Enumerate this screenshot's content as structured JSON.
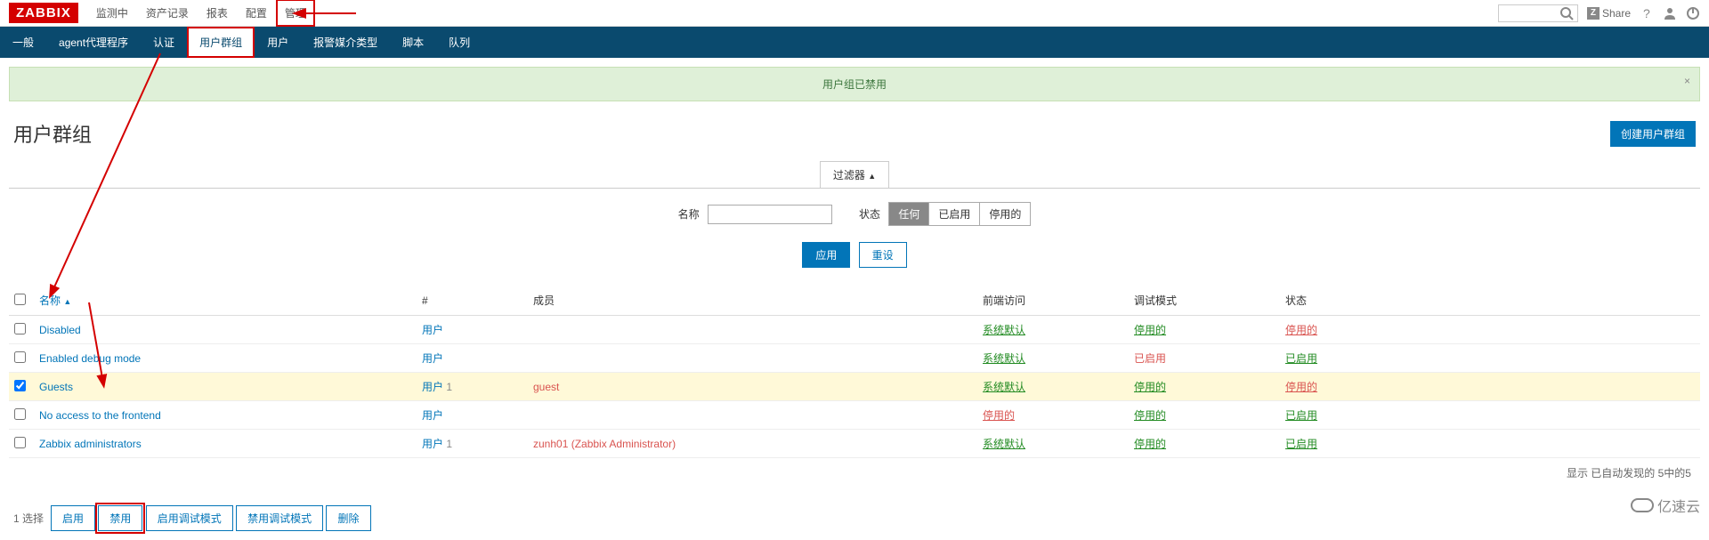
{
  "topnav": {
    "logo": "ZABBIX",
    "items": [
      "监测中",
      "资产记录",
      "报表",
      "配置",
      "管理"
    ],
    "active_index": 4,
    "share": "Share"
  },
  "subnav": {
    "items": [
      "一般",
      "agent代理程序",
      "认证",
      "用户群组",
      "用户",
      "报警媒介类型",
      "脚本",
      "队列"
    ],
    "active_index": 3
  },
  "notice": {
    "text": "用户组已禁用"
  },
  "page": {
    "title": "用户群组",
    "create_btn": "创建用户群组"
  },
  "filter": {
    "tab": "过滤器",
    "name_label": "名称",
    "status_label": "状态",
    "status_opts": [
      "任何",
      "已启用",
      "停用的"
    ],
    "status_sel": 0,
    "apply": "应用",
    "reset": "重设"
  },
  "table": {
    "headers": {
      "name": "名称",
      "num": "#",
      "members": "成员",
      "frontend": "前端访问",
      "debug": "调试模式",
      "status": "状态"
    },
    "rows": [
      {
        "checked": false,
        "name": "Disabled",
        "num_text": "用户",
        "num_n": "",
        "members": "",
        "frontend": "系统默认",
        "frontend_cls": "link-green",
        "debug": "停用的",
        "debug_cls": "link-green",
        "status": "停用的",
        "status_cls": "link-red"
      },
      {
        "checked": false,
        "name": "Enabled debug mode",
        "num_text": "用户",
        "num_n": "",
        "members": "",
        "frontend": "系统默认",
        "frontend_cls": "link-green",
        "debug": "已启用",
        "debug_cls": "link-orange",
        "status": "已启用",
        "status_cls": "link-green"
      },
      {
        "checked": true,
        "name": "Guests",
        "num_text": "用户",
        "num_n": "1",
        "members": "guest",
        "frontend": "系统默认",
        "frontend_cls": "link-green",
        "debug": "停用的",
        "debug_cls": "link-green",
        "status": "停用的",
        "status_cls": "link-red"
      },
      {
        "checked": false,
        "name": "No access to the frontend",
        "num_text": "用户",
        "num_n": "",
        "members": "",
        "frontend": "停用的",
        "frontend_cls": "link-red",
        "debug": "停用的",
        "debug_cls": "link-green",
        "status": "已启用",
        "status_cls": "link-green"
      },
      {
        "checked": false,
        "name": "Zabbix administrators",
        "num_text": "用户",
        "num_n": "1",
        "members": "zunh01 (Zabbix Administrator)",
        "frontend": "系统默认",
        "frontend_cls": "link-green",
        "debug": "停用的",
        "debug_cls": "link-green",
        "status": "已启用",
        "status_cls": "link-green"
      }
    ],
    "footer": "显示 已自动发现的 5中的5"
  },
  "actions": {
    "selected_n": "1",
    "selected_suffix": "选择",
    "buttons": [
      "启用",
      "禁用",
      "启用调试模式",
      "禁用调试模式",
      "删除"
    ],
    "highlight_index": 1
  },
  "watermark": "亿速云"
}
